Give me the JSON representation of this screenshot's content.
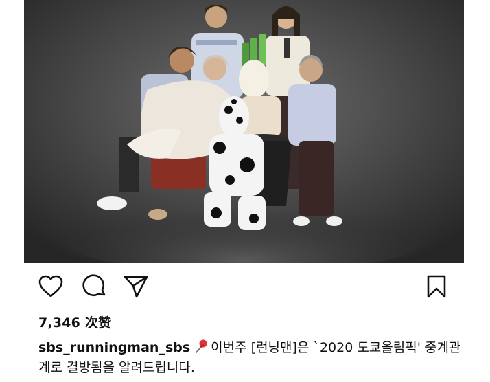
{
  "post": {
    "image_alt": "",
    "likes_text": "7,346 次赞",
    "username": "sbs_runningman_sbs",
    "caption_text": "이번주 [런닝맨]은 `2020 도쿄올림픽' 중계관계로 결방됨을 알려드립니다.",
    "pin_emoji": "📌"
  },
  "icons": {
    "like": "heart-icon",
    "comment": "comment-bubble-icon",
    "share": "paper-plane-icon",
    "save": "bookmark-icon",
    "caption_emoji": "pushpin-icon"
  },
  "colors": {
    "background": "#ffffff",
    "text": "#111111",
    "photo_backdrop": "#4a4a4a",
    "pin_red": "#e0303a"
  }
}
